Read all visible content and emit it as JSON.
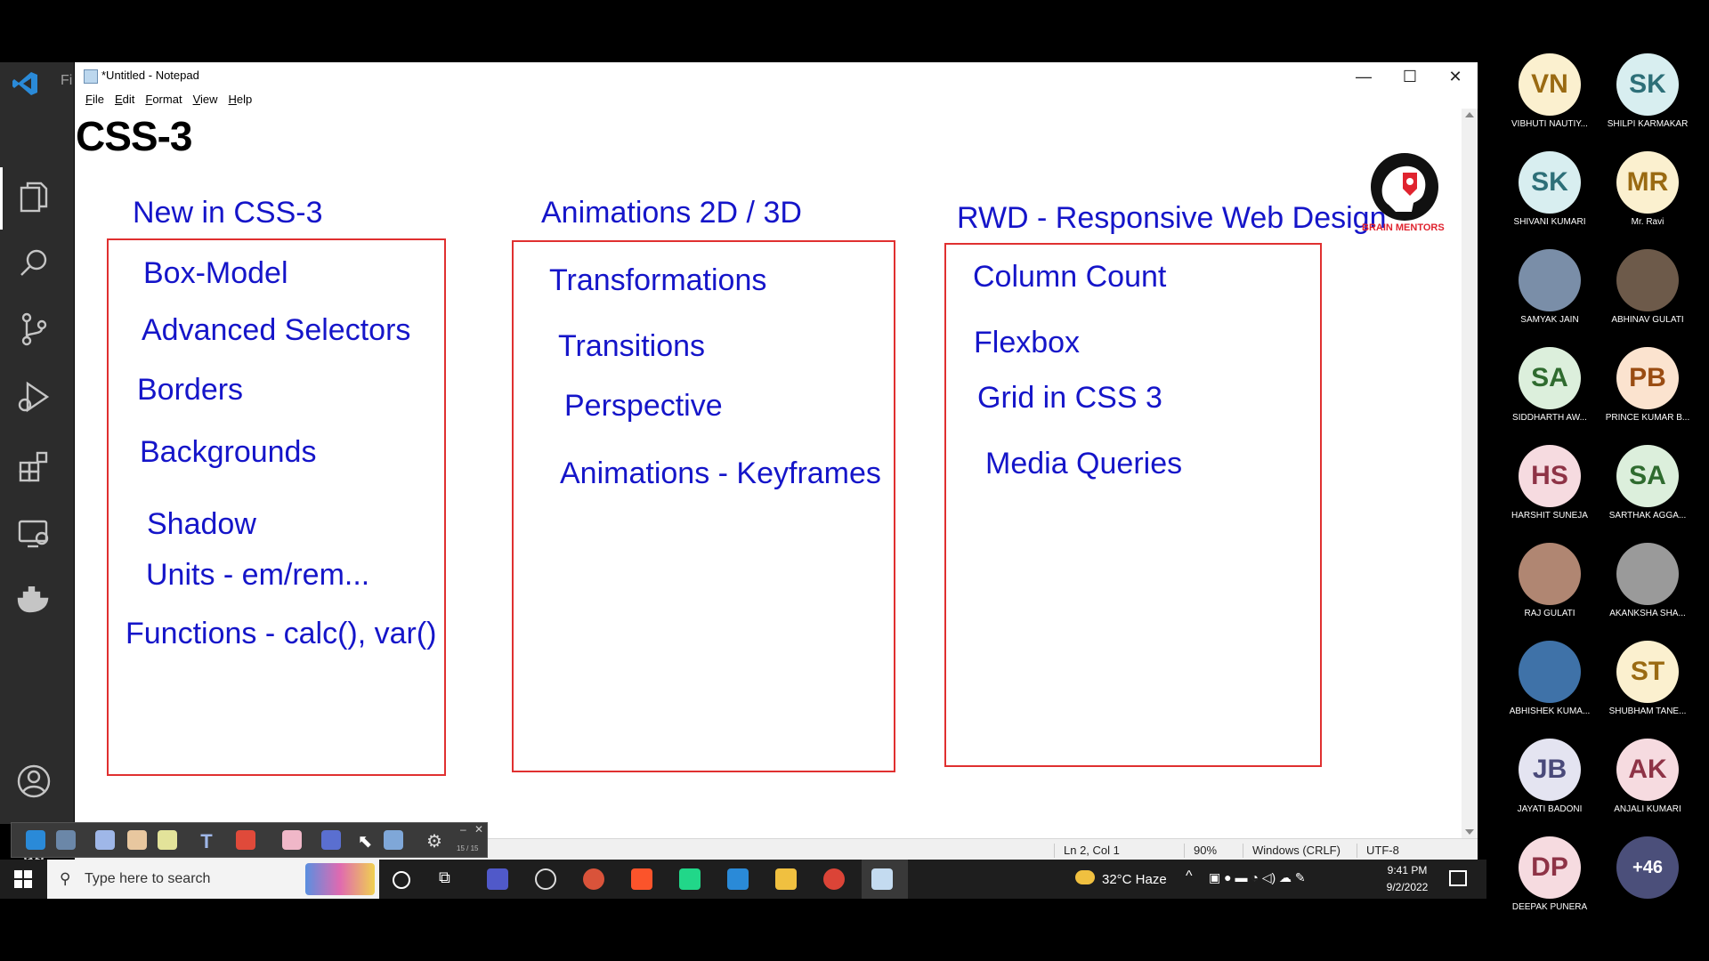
{
  "vscode": {
    "title_fragment": "Fi"
  },
  "notepad": {
    "title": "*Untitled - Notepad",
    "menu": [
      "File",
      "Edit",
      "Format",
      "View",
      "Help"
    ],
    "window_buttons": {
      "minimize": "—",
      "maximize": "☐",
      "close": "✕"
    },
    "status": {
      "position": "Ln 2, Col 1",
      "zoom": "90%",
      "line_ending": "Windows (CRLF)",
      "encoding": "UTF-8"
    }
  },
  "slide": {
    "title": "CSS-3",
    "columns": [
      {
        "heading": "New in CSS-3",
        "items": [
          "Box-Model",
          "Advanced Selectors",
          "Borders",
          "Backgrounds",
          "Shadow",
          "Units - em/rem...",
          "Functions - calc(), var()"
        ]
      },
      {
        "heading": "Animations  2D / 3D",
        "items": [
          "Transformations",
          "Transitions",
          "Perspective",
          "Animations - Keyframes"
        ]
      },
      {
        "heading": "RWD - Responsive Web Design",
        "items": [
          "Column Count",
          "Flexbox",
          "Grid in CSS 3",
          "Media Queries"
        ]
      }
    ],
    "brand_name": "BRAIN MENTORS"
  },
  "annotation_toolbar": {
    "page_indicator": "15 / 15"
  },
  "taskbar": {
    "search_placeholder": "Type here to search",
    "weather": "32°C  Haze",
    "time": "9:41 PM",
    "date": "9/2/2022"
  },
  "participants": [
    {
      "initials": "VN",
      "name": "VIBHUTI  NAUTIY...",
      "bg": "#fbf0cf",
      "fg": "#9a6a12"
    },
    {
      "initials": "SK",
      "name": "SHILPI  KARMAKAR",
      "bg": "#d8eef0",
      "fg": "#2d6f78"
    },
    {
      "initials": "SK",
      "name": "SHIVANI  KUMARI",
      "bg": "#d8eef0",
      "fg": "#2d6f78"
    },
    {
      "initials": "MR",
      "name": "Mr. Ravi",
      "bg": "#fbf0cf",
      "fg": "#9a6a12"
    },
    {
      "initials": "",
      "name": "SAMYAK  JAIN",
      "bg": "#7a8ea8",
      "fg": "#fff"
    },
    {
      "initials": "",
      "name": "ABHINAV  GULATI",
      "bg": "#6d5a4a",
      "fg": "#fff"
    },
    {
      "initials": "SA",
      "name": "SIDDHARTH  AW...",
      "bg": "#dcefdc",
      "fg": "#2f6b2f"
    },
    {
      "initials": "PB",
      "name": "PRINCE KUMAR B...",
      "bg": "#fbe3cf",
      "fg": "#9a4c12"
    },
    {
      "initials": "HS",
      "name": "HARSHIT  SUNEJA",
      "bg": "#f6dbe0",
      "fg": "#8e3346"
    },
    {
      "initials": "SA",
      "name": "SARTHAK  AGGA...",
      "bg": "#dcefdc",
      "fg": "#2f6b2f"
    },
    {
      "initials": "",
      "name": "RAJ  GULATI",
      "bg": "#b08672",
      "fg": "#fff"
    },
    {
      "initials": "",
      "name": "AKANKSHA  SHA...",
      "bg": "#9a9a9a",
      "fg": "#fff"
    },
    {
      "initials": "",
      "name": "ABHISHEK  KUMA...",
      "bg": "#3f72a8",
      "fg": "#fff"
    },
    {
      "initials": "ST",
      "name": "SHUBHAM  TANE...",
      "bg": "#fbf0cf",
      "fg": "#9a6a12"
    },
    {
      "initials": "JB",
      "name": "JAYATI  BADONI",
      "bg": "#e4e4f1",
      "fg": "#4a4a7a"
    },
    {
      "initials": "AK",
      "name": "ANJALI  KUMARI",
      "bg": "#f6dbe0",
      "fg": "#8e3346"
    },
    {
      "initials": "DP",
      "name": "DEEPAK  PUNERA",
      "bg": "#f6dbe0",
      "fg": "#8e3346"
    },
    {
      "initials": "+46",
      "name": "",
      "bg": "#4b4f7a",
      "fg": "#fff"
    }
  ]
}
